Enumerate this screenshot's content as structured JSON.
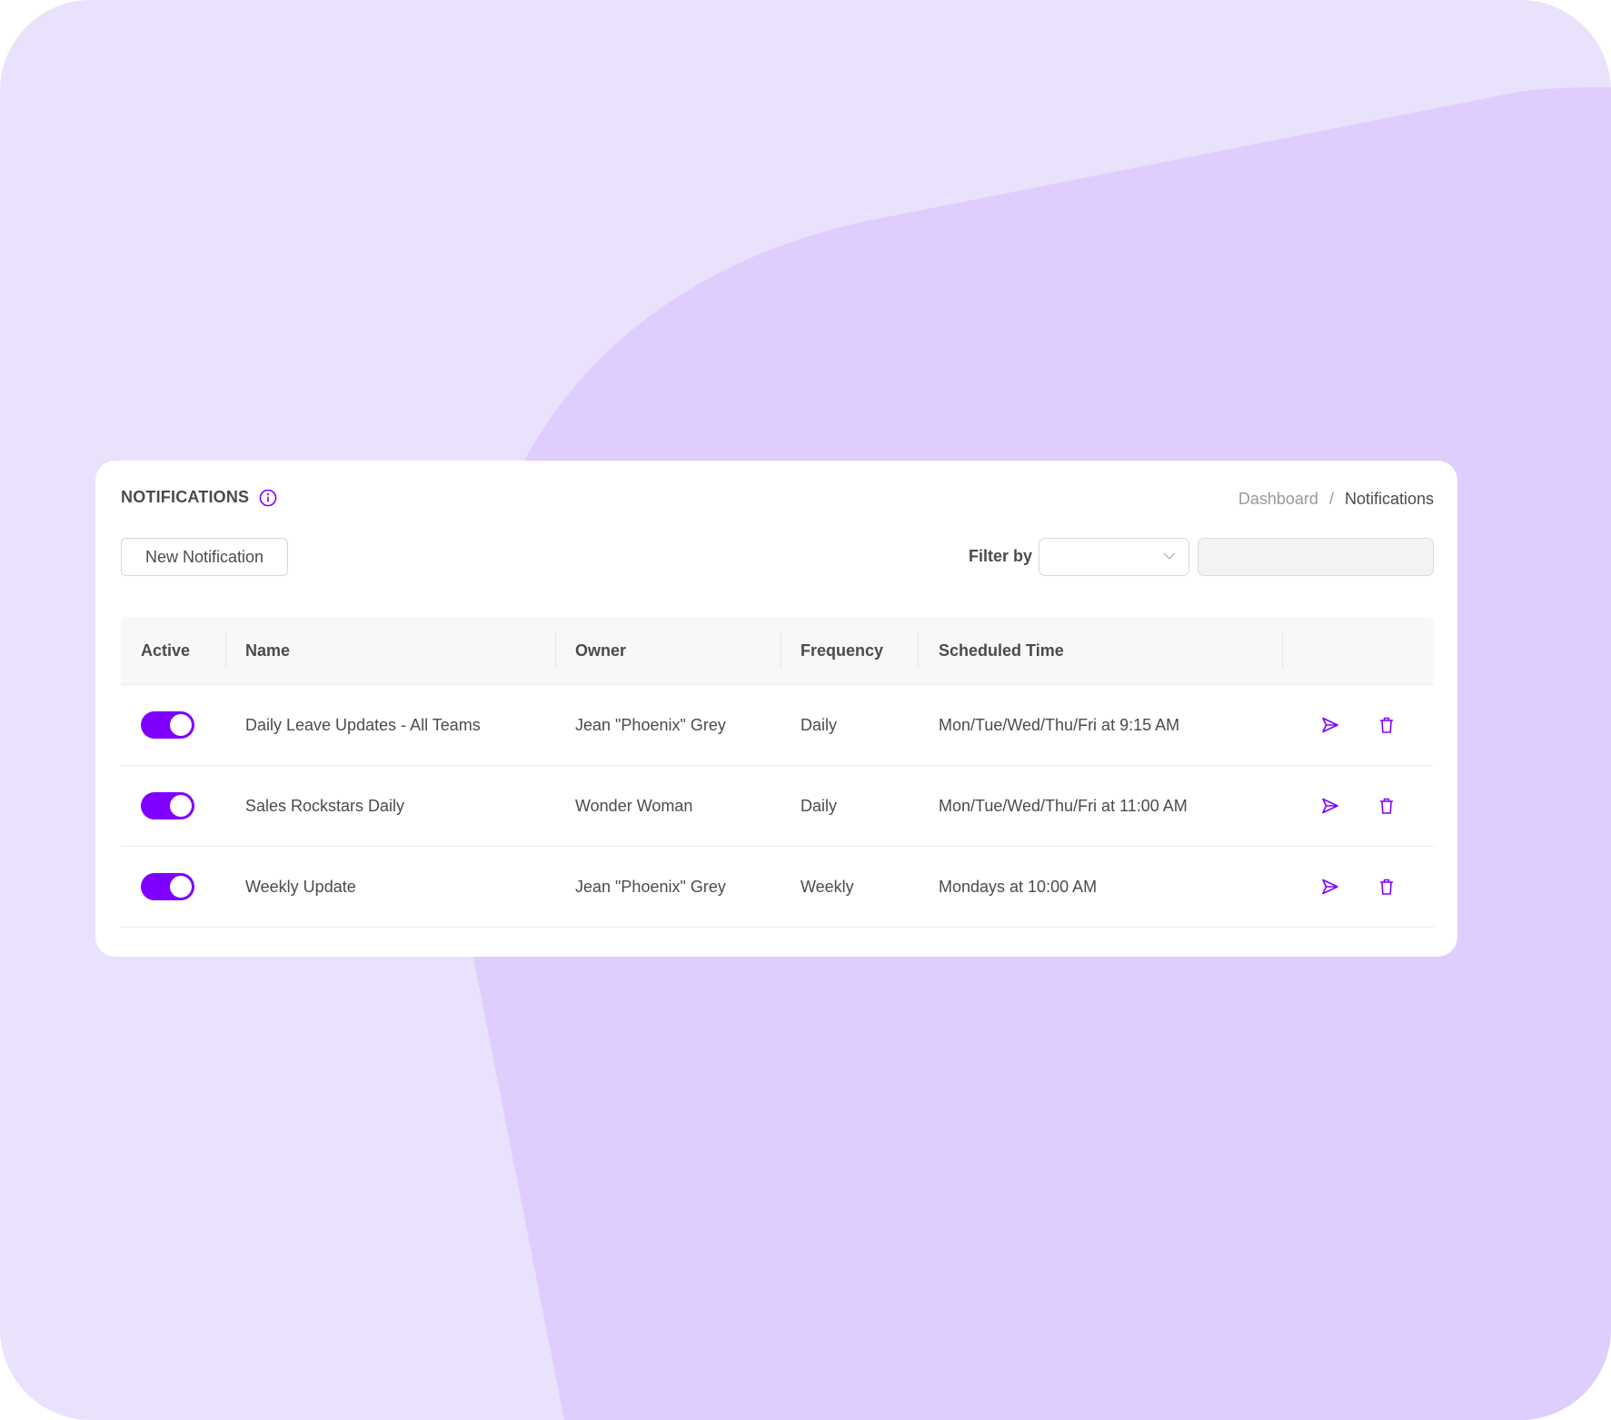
{
  "colors": {
    "accent": "#7f00ff",
    "background_light": "#eae1fd",
    "background_dark": "#dfcdfd",
    "text": "#4b4b4b",
    "muted": "#9a9a9a"
  },
  "header": {
    "title": "NOTIFICATIONS",
    "info_icon": "info-circle-icon"
  },
  "breadcrumb": {
    "items": [
      {
        "label": "Dashboard",
        "current": false
      },
      {
        "label": "Notifications",
        "current": true
      }
    ],
    "separator": "/"
  },
  "toolbar": {
    "new_button_label": "New Notification",
    "filter_label": "Filter by",
    "filter_select_value": "",
    "filter_input_value": "",
    "filter_input_placeholder": ""
  },
  "table": {
    "columns": [
      "Active",
      "Name",
      "Owner",
      "Frequency",
      "Scheduled Time",
      ""
    ],
    "rows": [
      {
        "active": true,
        "name": "Daily Leave Updates - All Teams",
        "owner": "Jean \"Phoenix\" Grey",
        "frequency": "Daily",
        "scheduled_time": "Mon/Tue/Wed/Thu/Fri at 9:15 AM",
        "actions": [
          "send-icon",
          "trash-icon"
        ]
      },
      {
        "active": true,
        "name": "Sales Rockstars Daily",
        "owner": "Wonder Woman",
        "frequency": "Daily",
        "scheduled_time": "Mon/Tue/Wed/Thu/Fri at 11:00 AM",
        "actions": [
          "send-icon",
          "trash-icon"
        ]
      },
      {
        "active": true,
        "name": "Weekly Update",
        "owner": "Jean \"Phoenix\" Grey",
        "frequency": "Weekly",
        "scheduled_time": "Mondays at 10:00 AM",
        "actions": [
          "send-icon",
          "trash-icon"
        ]
      }
    ]
  }
}
